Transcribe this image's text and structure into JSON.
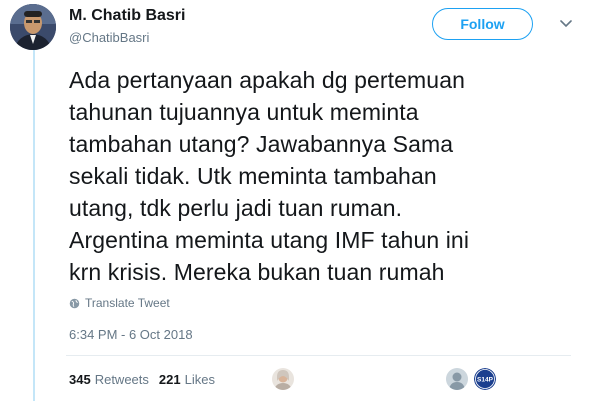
{
  "author": {
    "name": "M. Chatib Basri",
    "handle": "@ChatibBasri",
    "avatar_icon": "user-avatar"
  },
  "follow_button": {
    "label": "Follow"
  },
  "menu": {
    "icon": "chevron-down-icon"
  },
  "tweet": {
    "lines": [
      "Ada pertanyaan apakah dg pertemuan",
      "tahunan tujuannya untuk meminta",
      "tambahan utang? Jawabannya Sama",
      "sekali tidak. Utk meminta tambahan",
      "utang, tdk perlu jadi tuan ruman.",
      "Argentina meminta utang IMF tahun ini",
      "krn krisis. Mereka bukan tuan rumah"
    ],
    "translate_label": "Translate Tweet",
    "timestamp": "6:34 PM - 6 Oct 2018"
  },
  "stats": {
    "retweets_count": "345",
    "retweets_label": "Retweets",
    "likes_count": "221",
    "likes_label": "Likes"
  },
  "likers": [
    {
      "icon": "liker-avatar-woman"
    },
    {
      "icon": "liker-avatar-default"
    },
    {
      "icon": "liker-avatar-s14p",
      "badge_text": "S14P"
    }
  ],
  "colors": {
    "accent": "#1da1f2",
    "secondary_text": "#657786",
    "thread_line": "#c4e6f8"
  }
}
